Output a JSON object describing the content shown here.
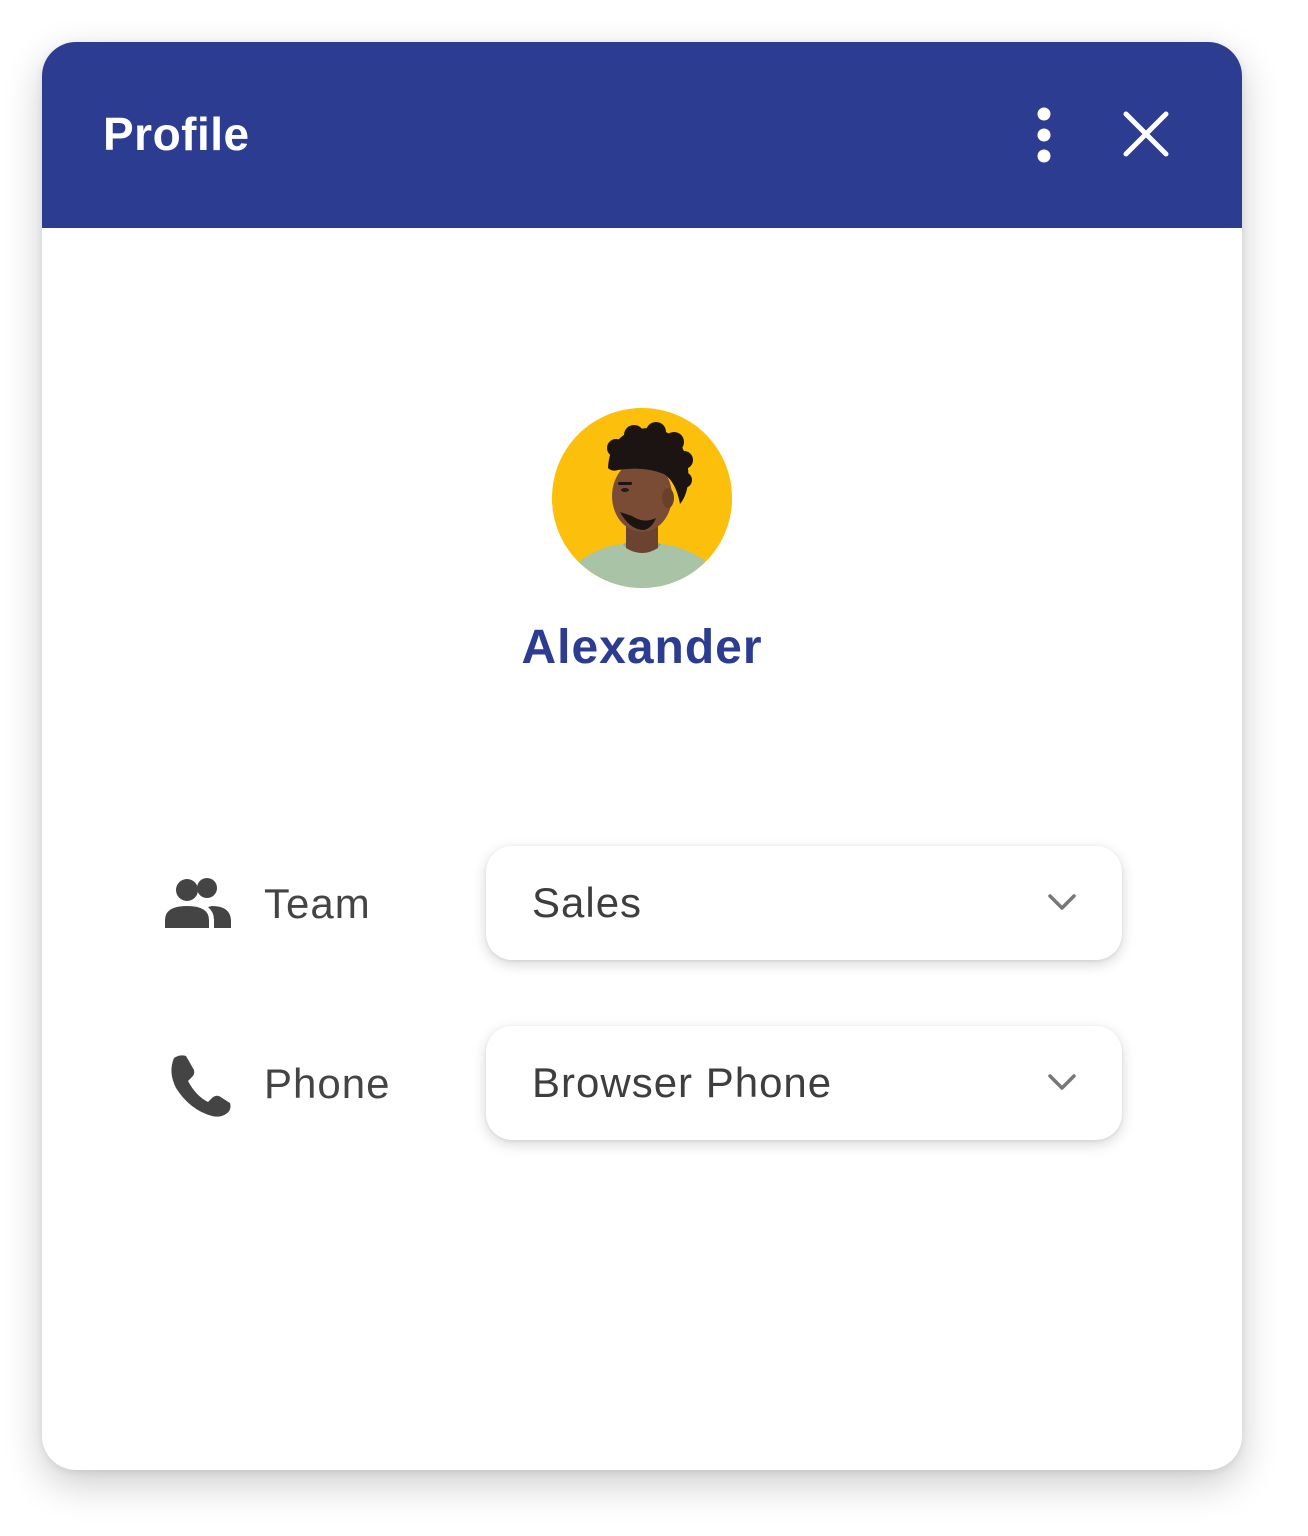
{
  "header": {
    "title": "Profile",
    "background_color": "#2c3c90",
    "actions": [
      {
        "icon": "more-vertical-icon"
      },
      {
        "icon": "close-icon"
      }
    ]
  },
  "profile": {
    "avatar": {
      "icon": "user-photo-avatar",
      "background_color": "#fbbf0c"
    },
    "name": "Alexander",
    "name_color": "#2c3c90"
  },
  "fields": {
    "team": {
      "icon": "group-icon",
      "label": "Team",
      "value": "Sales"
    },
    "phone": {
      "icon": "phone-icon",
      "label": "Phone",
      "value": "Browser Phone"
    }
  }
}
